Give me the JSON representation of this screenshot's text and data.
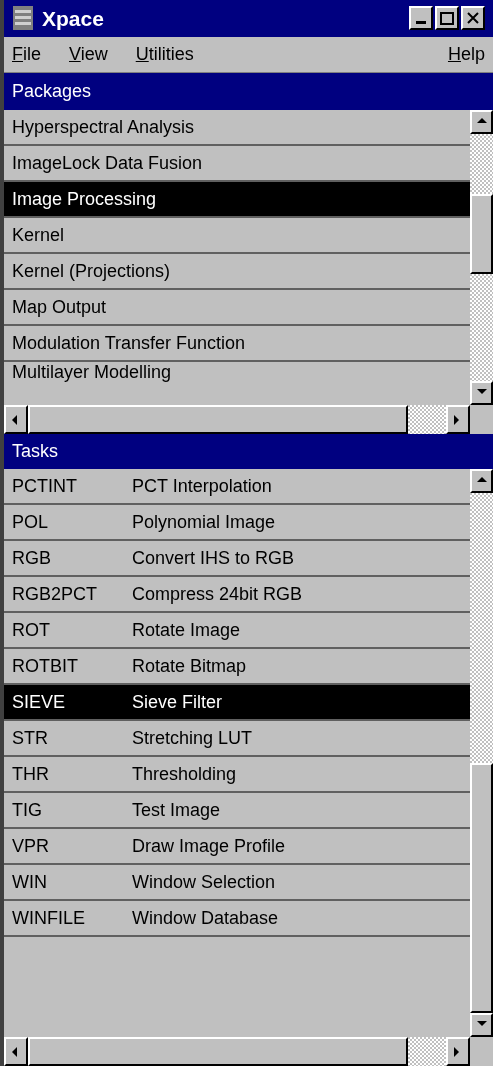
{
  "window": {
    "title": "Xpace"
  },
  "menu": [
    {
      "label": "File"
    },
    {
      "label": "View"
    },
    {
      "label": "Utilities"
    },
    {
      "label": "Help"
    }
  ],
  "packages": {
    "header": "Packages",
    "items": [
      {
        "label": "Hyperspectral Analysis",
        "selected": false
      },
      {
        "label": "ImageLock Data Fusion",
        "selected": false
      },
      {
        "label": "Image Processing",
        "selected": true
      },
      {
        "label": "Kernel",
        "selected": false
      },
      {
        "label": "Kernel (Projections)",
        "selected": false
      },
      {
        "label": "Map Output",
        "selected": false
      },
      {
        "label": "Modulation Transfer Function",
        "selected": false
      },
      {
        "label": "Multilayer Modelling",
        "selected": false
      }
    ]
  },
  "tasks": {
    "header": "Tasks",
    "items": [
      {
        "code": "PCTINT",
        "name": "PCT Interpolation",
        "selected": false
      },
      {
        "code": "POL",
        "name": "Polynomial Image",
        "selected": false
      },
      {
        "code": "RGB",
        "name": "Convert IHS to RGB",
        "selected": false
      },
      {
        "code": "RGB2PCT",
        "name": "Compress 24bit RGB",
        "selected": false
      },
      {
        "code": "ROT",
        "name": "Rotate Image",
        "selected": false
      },
      {
        "code": "ROTBIT",
        "name": "Rotate Bitmap",
        "selected": false
      },
      {
        "code": "SIEVE",
        "name": "Sieve Filter",
        "selected": true
      },
      {
        "code": "STR",
        "name": "Stretching LUT",
        "selected": false
      },
      {
        "code": "THR",
        "name": "Thresholding",
        "selected": false
      },
      {
        "code": "TIG",
        "name": "Test Image",
        "selected": false
      },
      {
        "code": "VPR",
        "name": "Draw Image Profile",
        "selected": false
      },
      {
        "code": "WIN",
        "name": "Window Selection",
        "selected": false
      },
      {
        "code": "WINFILE",
        "name": "Window Database",
        "selected": false
      }
    ]
  }
}
